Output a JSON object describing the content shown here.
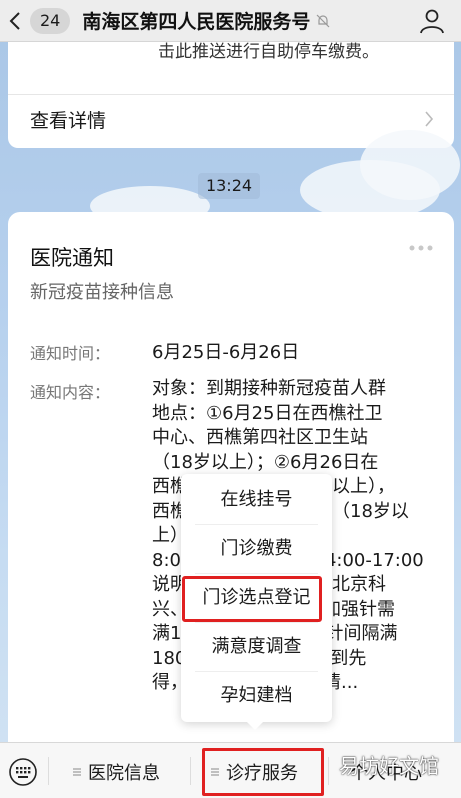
{
  "header": {
    "badge": "24",
    "title": "南海区第四人民医院服务号"
  },
  "top_card": {
    "truncated_text": "击此推送进行自助停车缴费。",
    "detail_label": "查看详情"
  },
  "time": "13:24",
  "notice": {
    "title": "医院通知",
    "subtitle": "新冠疫苗接种信息",
    "time_label": "通知时间：",
    "time_value": "6月25日-6月26日",
    "content_label": "通知内容：",
    "content_lines": [
      "对象：到期接种新冠疫苗人群",
      "地点：①6月25日在西樵社卫",
      "中心、西樵第四社区卫生站",
      "（18岁以上）；②6月26日在",
      "西樵　　　　　　　　以上），",
      "西樵　　　　　　　站（18岁以",
      "上）",
      "8:0　　　　　　　　4:00-17:00",
      "说明　　　　　　　，北京科",
      "兴、　　　　　　　）加强针需",
      "满1　　　　　　　一针间隔满",
      "180　　　　　　，先到先",
      "得，　　　　　　　疫情..."
    ]
  },
  "popup_menu": {
    "items": [
      "在线挂号",
      "门诊缴费",
      "门诊选点登记",
      "满意度调查",
      "孕妇建档"
    ]
  },
  "bottom_bar": {
    "items": [
      "医院信息",
      "诊疗服务",
      "个人中心"
    ]
  },
  "watermark": "易坊好文馆",
  "colors": {
    "highlight": "#e02020",
    "background_top": "#a9c6e6"
  }
}
